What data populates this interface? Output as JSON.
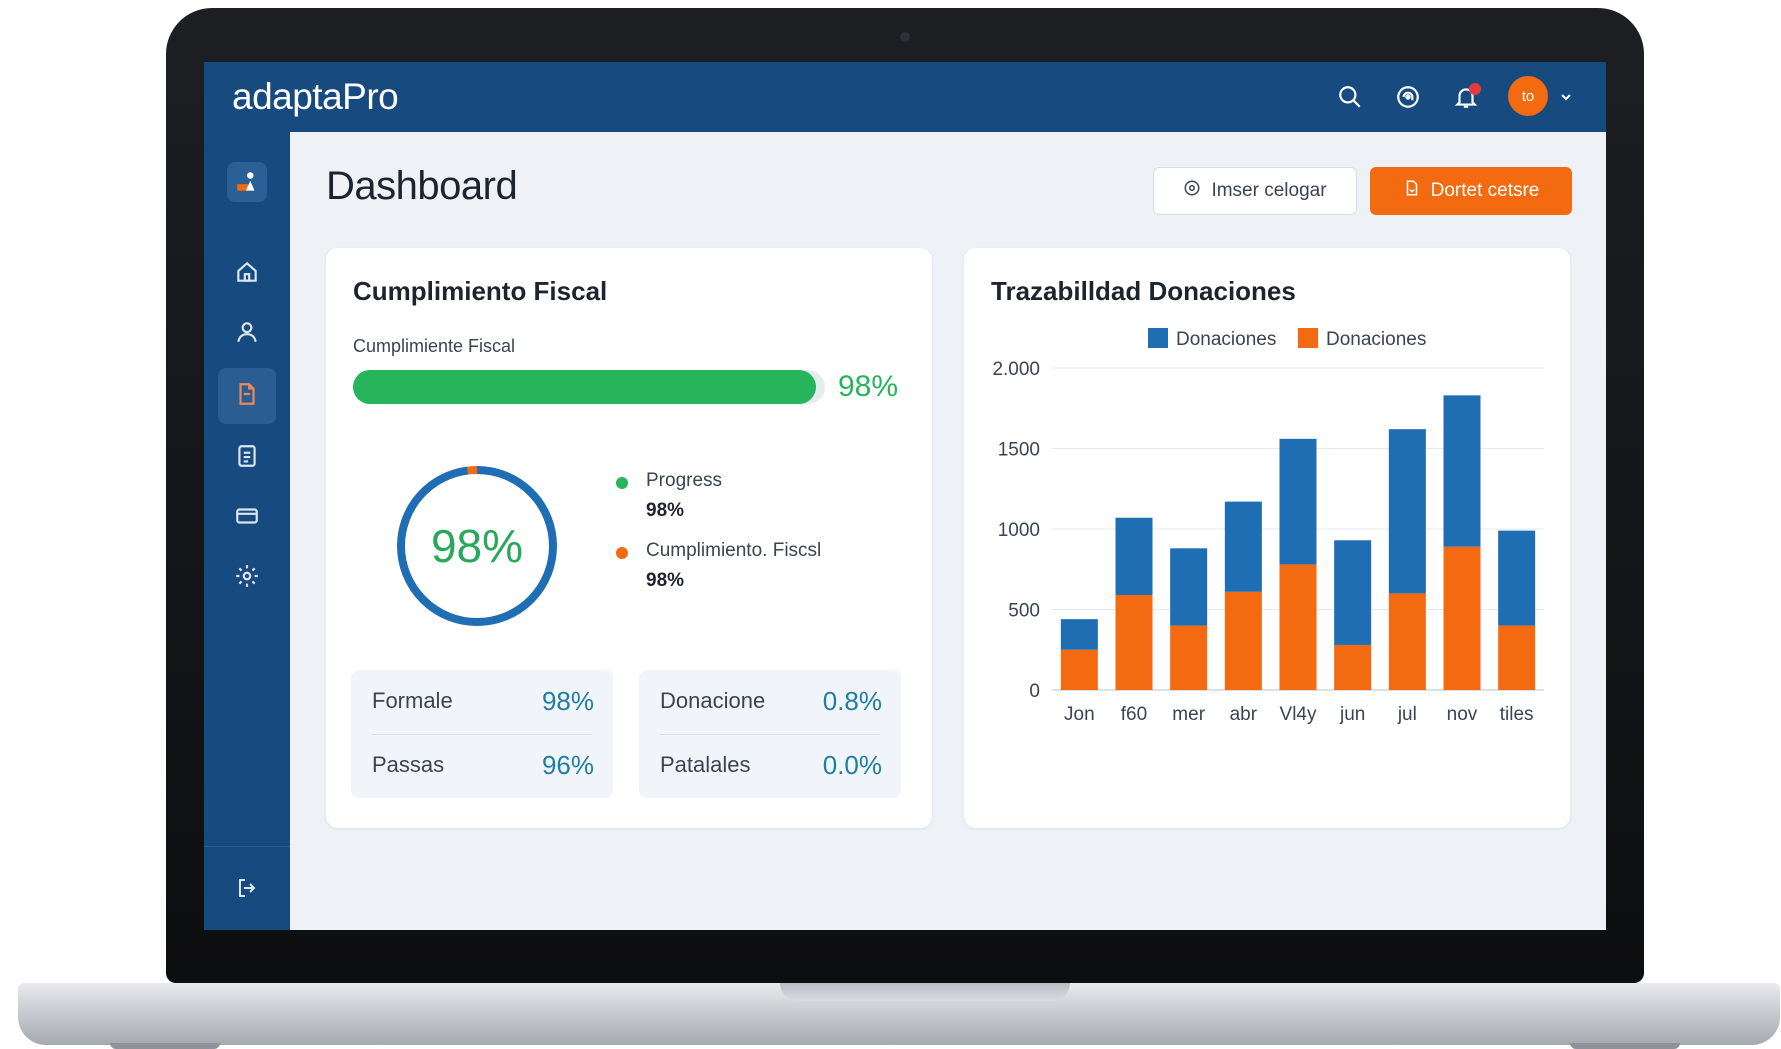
{
  "app": {
    "logo": "adaptaPro"
  },
  "header": {
    "icons": [
      "search-icon",
      "support-icon",
      "bell-icon"
    ],
    "avatar_initials": "to"
  },
  "sidebar": {
    "items": [
      "home-icon",
      "user-icon",
      "document-icon",
      "checklist-icon",
      "card-icon",
      "settings-icon"
    ],
    "footer": "logout-icon"
  },
  "page": {
    "title": "Dashboard",
    "secondary_button": "Imser celogar",
    "primary_button": "Dortet cetsre"
  },
  "fiscal": {
    "title": "Cumplimiento Fiscal",
    "bar_label": "Cumplimiente Fiscal",
    "bar_value": "98%",
    "bar_fraction": 0.98,
    "ring_value": "98%",
    "ring_fraction": 0.98,
    "legend": [
      {
        "name": "Progress",
        "value": "98%",
        "color": "#27b45b"
      },
      {
        "name": "Cumplimiento. Fiscsl",
        "value": "98%",
        "color": "#f36a10"
      }
    ],
    "stats_left": [
      {
        "name": "Formale",
        "value": "98%"
      },
      {
        "name": "Passas",
        "value": "96%"
      }
    ],
    "stats_right": [
      {
        "name": "Donacione",
        "value": "0.8%"
      },
      {
        "name": "Patalales",
        "value": "0.0%"
      }
    ]
  },
  "donations": {
    "title": "Trazabilldad Donaciones"
  },
  "colors": {
    "primary": "#174a7e",
    "accent": "#f36a10",
    "success": "#27b45b",
    "chart_blue": "#1f6db3"
  },
  "chart_data": {
    "type": "bar",
    "stacked": true,
    "categories": [
      "Jon",
      "f60",
      "mer",
      "abr",
      "Vl4y",
      "jun",
      "jul",
      "nov",
      "tiles"
    ],
    "series": [
      {
        "name": "Donaciones",
        "color": "#f36a10",
        "values": [
          250,
          590,
          400,
          610,
          780,
          280,
          600,
          890,
          400
        ]
      },
      {
        "name": "Donaciones",
        "color": "#1f6db3",
        "values": [
          190,
          480,
          480,
          560,
          780,
          650,
          1020,
          940,
          590
        ]
      }
    ],
    "legend_order": [
      1,
      0
    ],
    "y_ticks": [
      "2.000",
      "1500",
      "1000",
      "500",
      "0"
    ],
    "y_tick_values": [
      2000,
      1500,
      1000,
      500,
      0
    ],
    "ylim": [
      0,
      2000
    ],
    "grid": true,
    "legend": "top"
  }
}
